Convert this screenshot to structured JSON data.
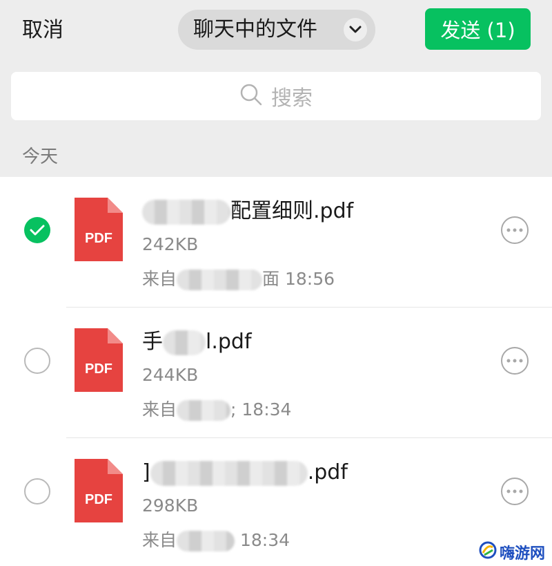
{
  "header": {
    "cancel_label": "取消",
    "title": "聊天中的文件",
    "send_label": "发送 (1)"
  },
  "search": {
    "placeholder": "搜索"
  },
  "section": {
    "label": "今天"
  },
  "files": [
    {
      "name_suffix": "配置细则.pdf",
      "size": "242KB",
      "from_prefix": "来自",
      "from_time_prefix": "面",
      "time": "18:56",
      "selected": true,
      "icon_label": "PDF"
    },
    {
      "name_prefix": "手",
      "name_suffix": "l.pdf",
      "size": "244KB",
      "from_prefix": "来自",
      "from_time_prefix": ";",
      "time": "18:34",
      "selected": false,
      "icon_label": "PDF"
    },
    {
      "name_prefix": "]",
      "name_suffix": ".pdf",
      "size": "298KB",
      "from_prefix": "来自",
      "time": "18:34",
      "selected": false,
      "icon_label": "PDF"
    }
  ],
  "watermark": {
    "text": "嗨游网"
  },
  "colors": {
    "accent": "#07c160",
    "pdf_red": "#e64340",
    "background": "#ededed"
  },
  "icons": {
    "search": "search-icon",
    "chevron": "chevron-down-icon",
    "check": "check-icon",
    "more": "more-icon",
    "file": "pdf-file-icon"
  }
}
